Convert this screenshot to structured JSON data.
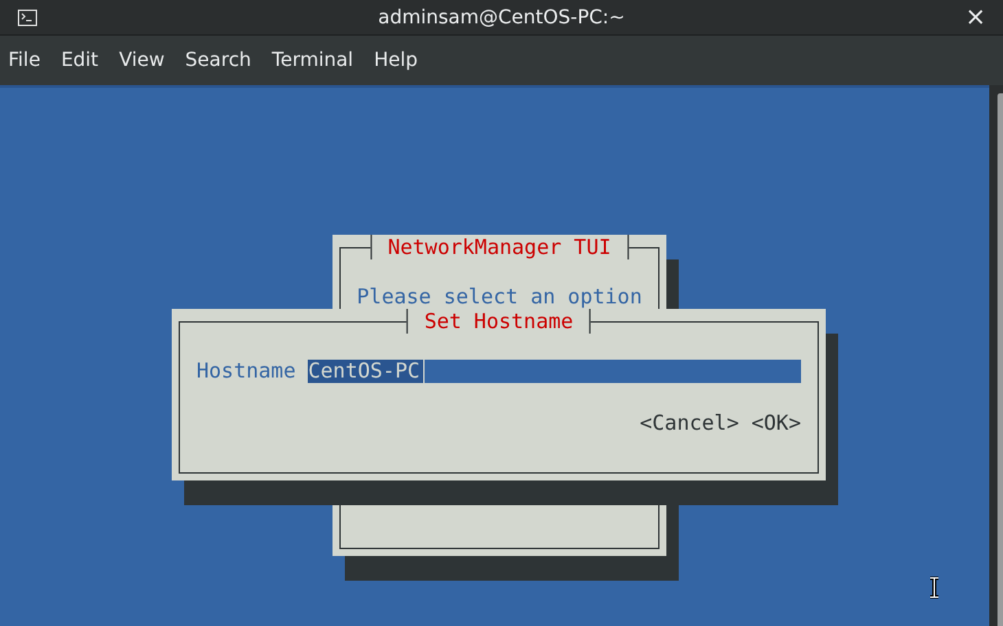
{
  "window": {
    "title": "adminsam@CentOS-PC:~",
    "close": "×"
  },
  "menu": [
    {
      "label": "File"
    },
    {
      "label": "Edit"
    },
    {
      "label": "View"
    },
    {
      "label": "Search"
    },
    {
      "label": "Terminal"
    },
    {
      "label": "Help"
    }
  ],
  "back_dialog": {
    "title": "NetworkManager TUI",
    "prompt": "Please select an option"
  },
  "front_dialog": {
    "title": "Set Hostname",
    "field": {
      "label": "Hostname",
      "value": "CentOS-PC",
      "text_selected": true
    },
    "buttons": [
      {
        "label": "<Cancel>"
      },
      {
        "label": "<OK>"
      }
    ]
  }
}
